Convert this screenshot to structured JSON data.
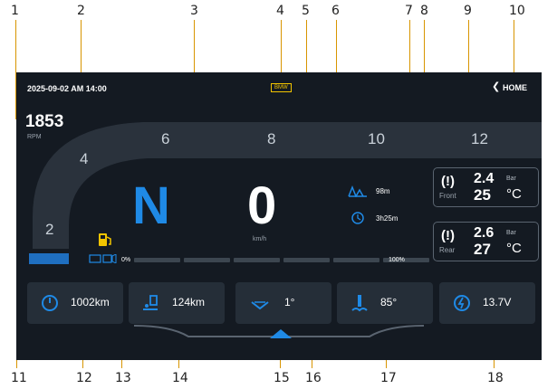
{
  "callouts": [
    "1",
    "2",
    "3",
    "4",
    "5",
    "6",
    "7",
    "8",
    "9",
    "10",
    "11",
    "12",
    "13",
    "14",
    "15",
    "16",
    "17",
    "18"
  ],
  "status_bar": {
    "datetime": "2025-09-02 AM 14:00",
    "logo_text": "BMW",
    "home_label": "HOME"
  },
  "rpm": {
    "value": "1853",
    "unit": "RPM",
    "scale_labels": [
      "2",
      "4",
      "6",
      "8",
      "10",
      "12"
    ]
  },
  "gear": "N",
  "speed": {
    "value": "0",
    "unit": "km/h"
  },
  "trip": {
    "distance": "98m",
    "time": "3h25m"
  },
  "battery_bar": {
    "min_label": "0%",
    "max_label": "100%",
    "level_percent": 0
  },
  "tires": {
    "front": {
      "label": "Front",
      "pressure": "2.4",
      "pressure_unit": "Bar",
      "temp": "25",
      "temp_unit": "°C"
    },
    "rear": {
      "label": "Rear",
      "pressure": "2.6",
      "pressure_unit": "Bar",
      "temp": "27",
      "temp_unit": "°C"
    }
  },
  "cards": [
    {
      "icon": "odometer-icon",
      "value": "1002km"
    },
    {
      "icon": "fuel-range-icon",
      "value": "124km"
    },
    {
      "icon": "lean-angle-icon",
      "value": "1°"
    },
    {
      "icon": "coolant-temp-icon",
      "value": "85°"
    },
    {
      "icon": "voltage-icon",
      "value": "13.7V"
    }
  ],
  "colors": {
    "accent": "#1f8ae6",
    "background": "#141a22",
    "warning": "#f2c400",
    "callout_line": "#d89500"
  }
}
